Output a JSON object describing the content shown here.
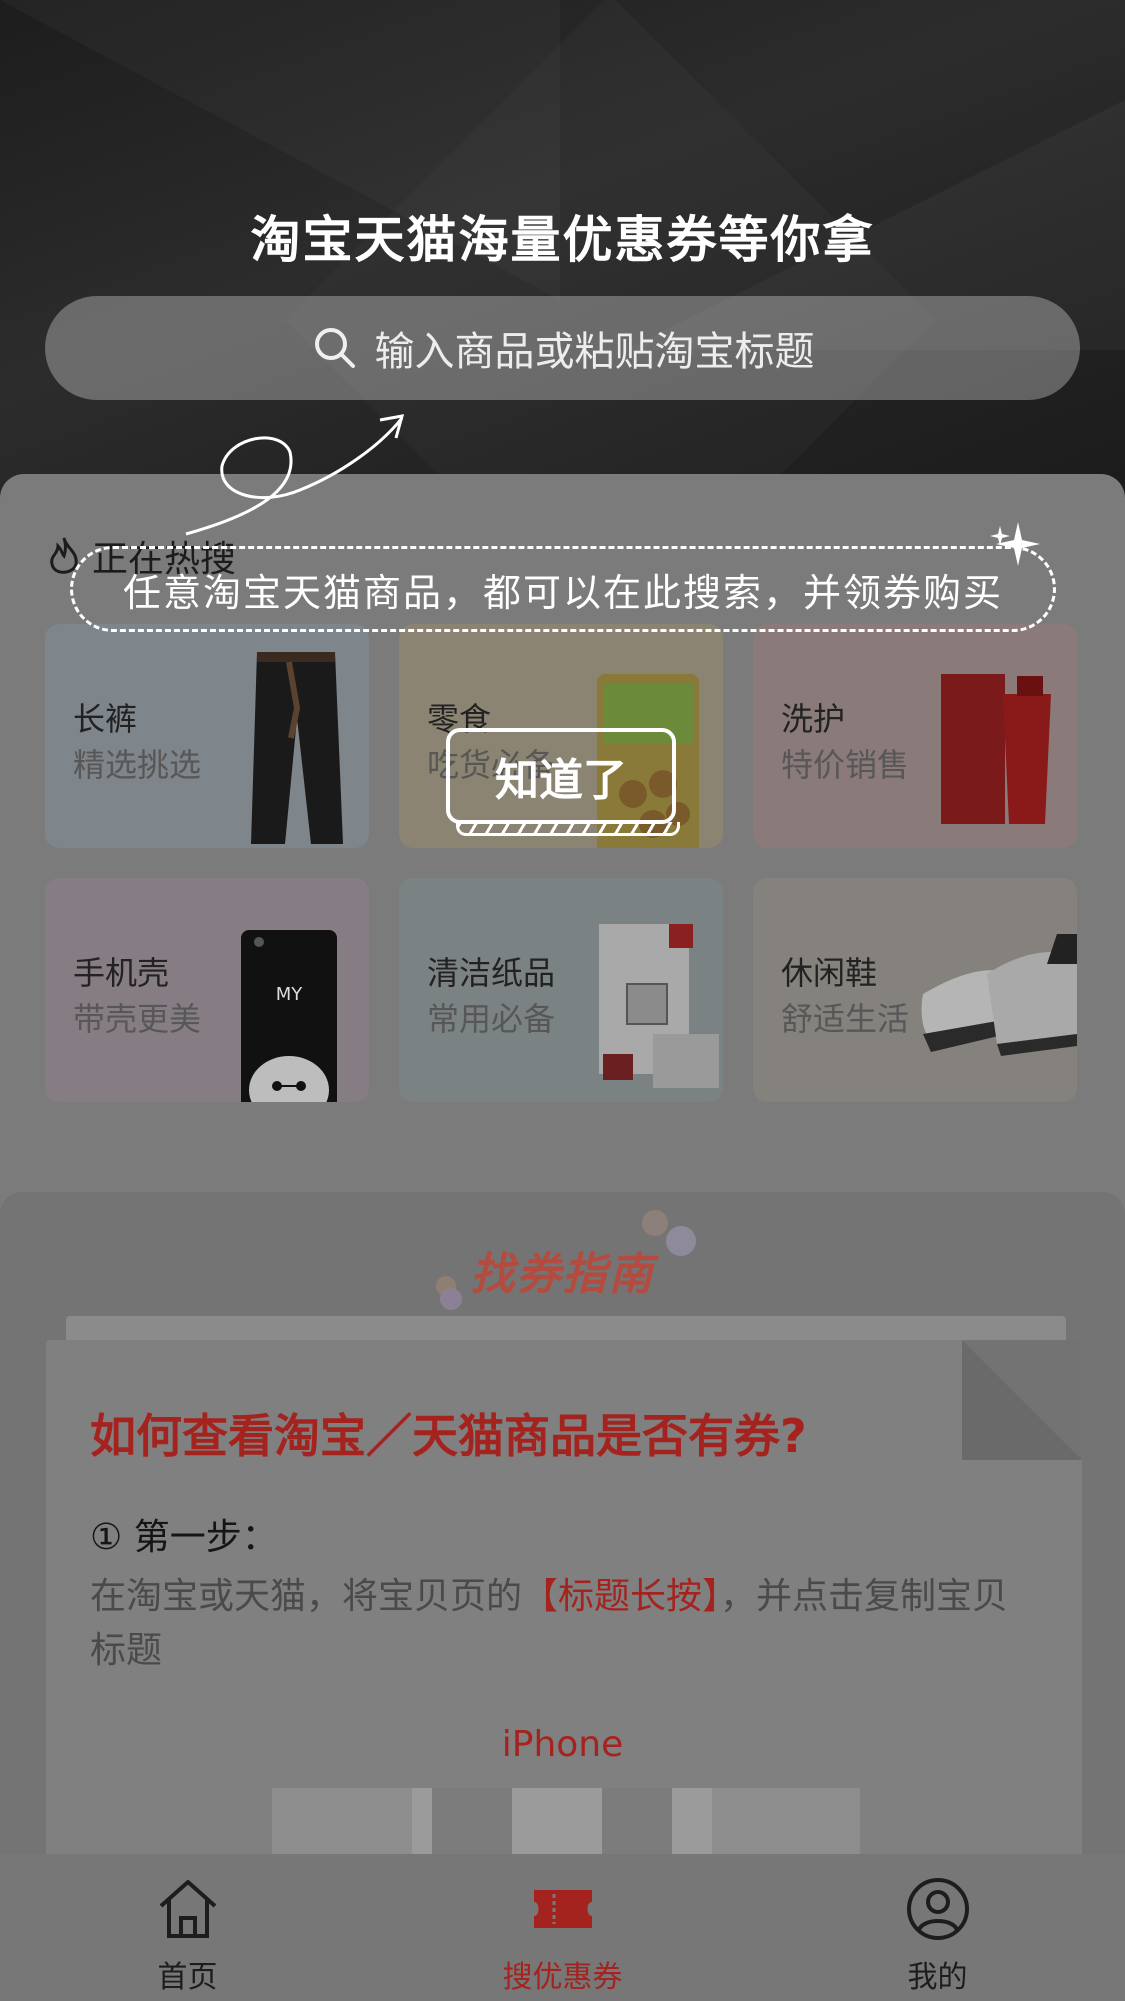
{
  "header": {
    "title": "淘宝天猫海量优惠券等你拿",
    "search_placeholder": "输入商品或粘贴淘宝标题",
    "search_icon": "search-icon"
  },
  "hot": {
    "title": "正在热搜",
    "icon": "flame-icon",
    "items": [
      {
        "name": "长裤",
        "sub": "精选挑选",
        "bg": "#7e858b"
      },
      {
        "name": "零食",
        "sub": "吃货必备",
        "bg": "#8b8472"
      },
      {
        "name": "洗护",
        "sub": "特价销售",
        "bg": "#8b7a7a"
      },
      {
        "name": "手机壳",
        "sub": "带壳更美",
        "bg": "#867d84"
      },
      {
        "name": "清洁纸品",
        "sub": "常用必备",
        "bg": "#7b8283"
      },
      {
        "name": "休闲鞋",
        "sub": "舒适生活",
        "bg": "#85817c"
      }
    ]
  },
  "guide": {
    "title": "找券指南",
    "question": "如何查看淘宝／天猫商品是否有券?",
    "step": "① 第一步：",
    "desc_before": "在淘宝或天猫，将宝贝页的",
    "desc_highlight": "【标题长按】",
    "desc_after": "，并点击复制宝贝标题",
    "phone_label": "iPhone"
  },
  "overlay": {
    "hint": "任意淘宝天猫商品，都可以在此搜索，并领券购买",
    "button": "知道了"
  },
  "tabbar": {
    "items": [
      {
        "label": "首页",
        "icon": "home-icon",
        "active": false
      },
      {
        "label": "搜优惠券",
        "icon": "ticket-icon",
        "active": true
      },
      {
        "label": "我的",
        "icon": "user-icon",
        "active": false
      }
    ]
  },
  "colors": {
    "accent": "#a5231f",
    "overlay_text": "#ffffff"
  }
}
